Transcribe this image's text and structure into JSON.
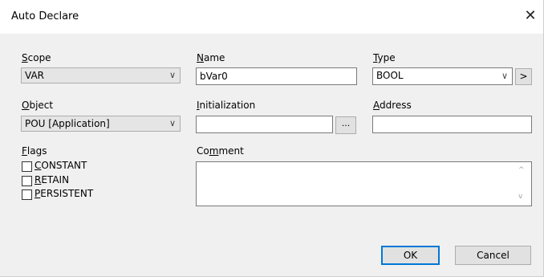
{
  "dialog": {
    "title": "Auto Declare",
    "close_glyph": "✕"
  },
  "scope": {
    "label_hot": "S",
    "label_rest": "cope",
    "value": "VAR",
    "arrow": "∨"
  },
  "name": {
    "label_hot": "N",
    "label_rest": "ame",
    "value": "bVar0"
  },
  "type": {
    "label_hot": "T",
    "label_rest": "ype",
    "value": "BOOL",
    "arrow": "∨",
    "more_button": ">"
  },
  "object": {
    "label_hot": "O",
    "label_rest": "bject",
    "value": "POU [Application]",
    "arrow": "∨"
  },
  "initialization": {
    "label_hot": "I",
    "label_rest": "nitialization",
    "value": "",
    "browse_button": "..."
  },
  "address": {
    "label_pre": "",
    "label_hot": "A",
    "label_rest": "ddress",
    "value": ""
  },
  "flags": {
    "label_hot": "F",
    "label_rest": "lags",
    "items": [
      {
        "hot": "C",
        "rest": "ONSTANT",
        "checked": false
      },
      {
        "hot": "R",
        "rest": "ETAIN",
        "checked": false
      },
      {
        "hot": "P",
        "rest": "ERSISTENT",
        "checked": false
      }
    ]
  },
  "comment": {
    "label_pre": "Co",
    "label_hot": "m",
    "label_rest": "ment",
    "value": "",
    "scroll_up": "^",
    "scroll_down": "v"
  },
  "buttons": {
    "ok": "OK",
    "cancel": "Cancel"
  },
  "colors": {
    "accent": "#0078d7",
    "background": "#f0f0f0",
    "titlebar": "#ffffff"
  }
}
